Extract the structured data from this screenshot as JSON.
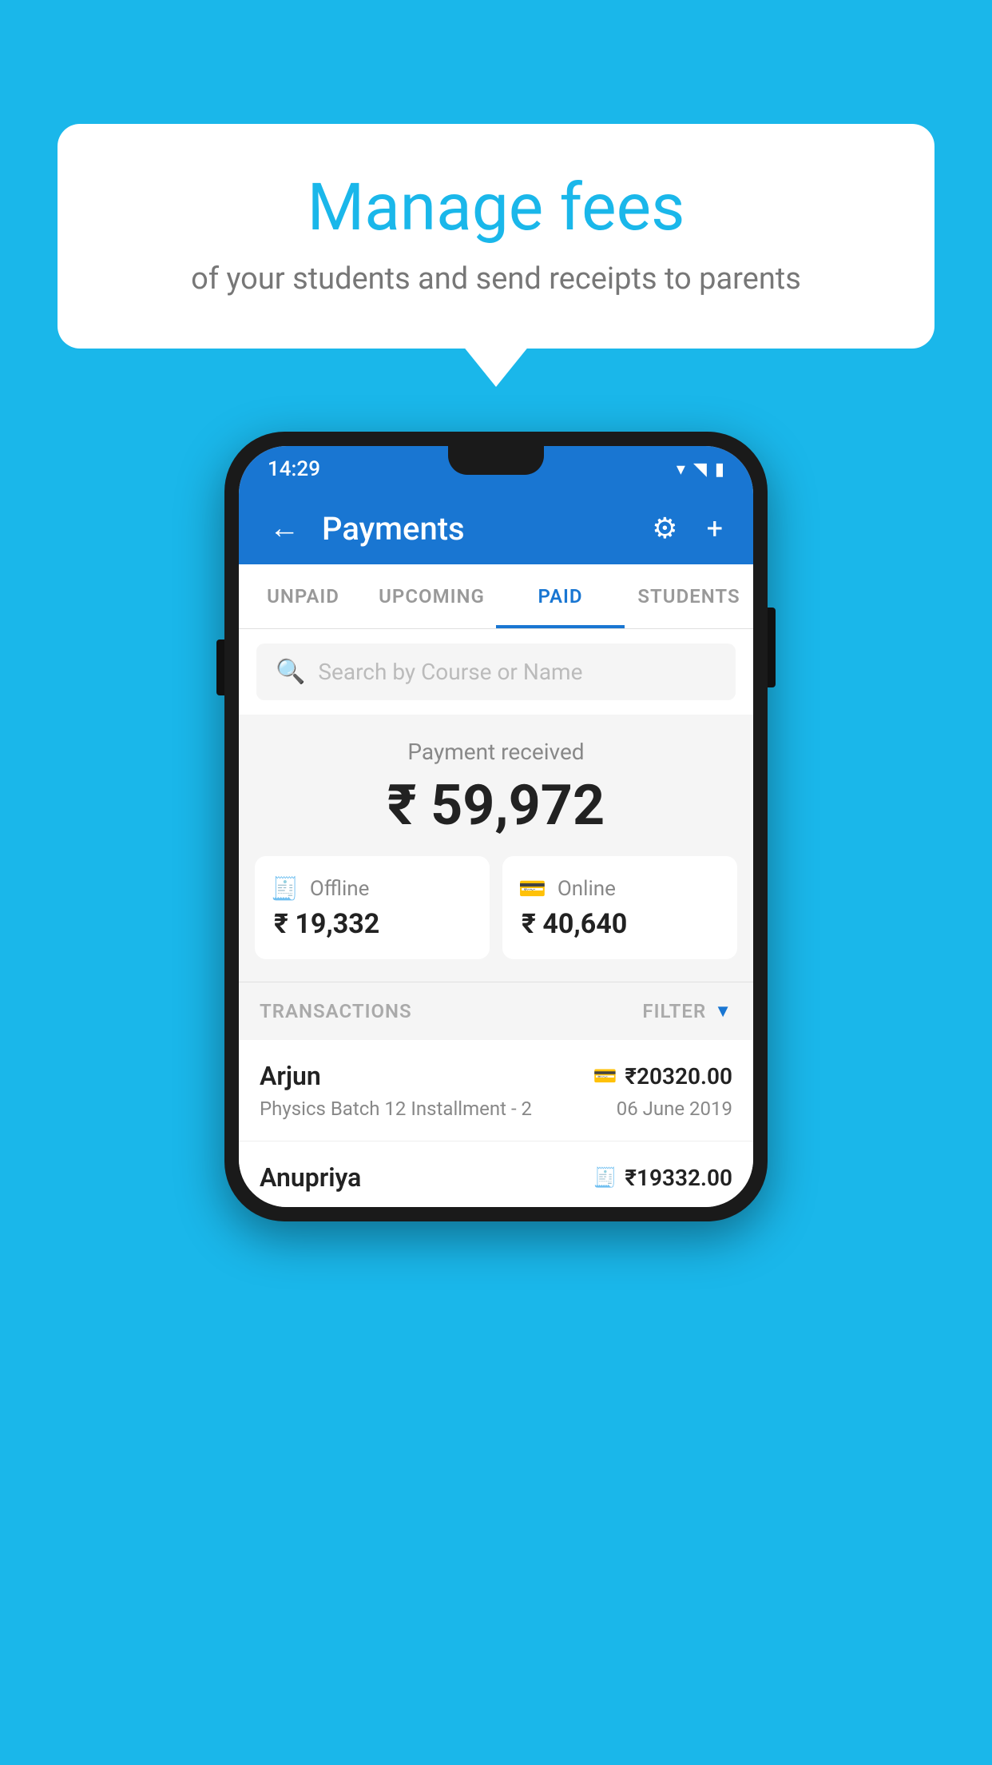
{
  "background": {
    "color": "#1ab7ea"
  },
  "speech_bubble": {
    "title": "Manage fees",
    "subtitle": "of your students and send receipts to parents"
  },
  "status_bar": {
    "time": "14:29",
    "wifi_icon": "▾",
    "signal_icon": "◥",
    "battery_icon": "▮"
  },
  "app_bar": {
    "back_label": "←",
    "title": "Payments",
    "gear_label": "⚙",
    "plus_label": "+"
  },
  "tabs": [
    {
      "label": "UNPAID",
      "active": false
    },
    {
      "label": "UPCOMING",
      "active": false
    },
    {
      "label": "PAID",
      "active": true
    },
    {
      "label": "STUDENTS",
      "active": false
    }
  ],
  "search": {
    "placeholder": "Search by Course or Name"
  },
  "payment_received": {
    "label": "Payment received",
    "amount": "₹ 59,972",
    "offline": {
      "icon": "🧾",
      "label": "Offline",
      "amount": "₹ 19,332"
    },
    "online": {
      "icon": "💳",
      "label": "Online",
      "amount": "₹ 40,640"
    }
  },
  "transactions": {
    "label": "TRANSACTIONS",
    "filter_label": "FILTER",
    "rows": [
      {
        "name": "Arjun",
        "payment_type_icon": "💳",
        "amount": "₹20320.00",
        "course": "Physics Batch 12 Installment - 2",
        "date": "06 June 2019"
      },
      {
        "name": "Anupriya",
        "payment_type_icon": "🧾",
        "amount": "₹19332.00",
        "course": "",
        "date": ""
      }
    ]
  }
}
